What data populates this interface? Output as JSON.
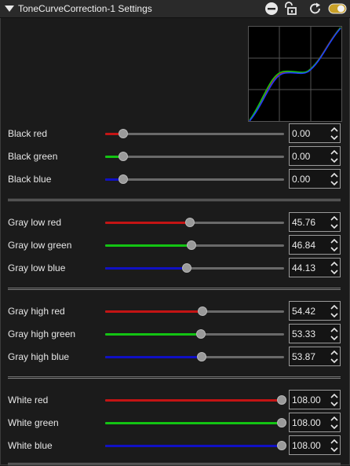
{
  "window": {
    "title": "ToneCurveCorrection-1 Settings"
  },
  "icons": {
    "collapse": "chevron-down-icon",
    "remove": "minus-circle-icon",
    "lock": "unlock-icon",
    "reset": "reset-icon",
    "toggle": "toggle-on-icon"
  },
  "colors": {
    "red": "#c41414",
    "green": "#13c413",
    "blue": "#1010c4",
    "toggle": "#c8a028"
  },
  "groups": [
    {
      "rows": [
        {
          "label": "Black red",
          "value": "0.00",
          "fraction": 0.1,
          "color": "red"
        },
        {
          "label": "Black green",
          "value": "0.00",
          "fraction": 0.1,
          "color": "green"
        },
        {
          "label": "Black blue",
          "value": "0.00",
          "fraction": 0.1,
          "color": "blue"
        }
      ]
    },
    {
      "rows": [
        {
          "label": "Gray low red",
          "value": "45.76",
          "fraction": 0.475,
          "color": "red"
        },
        {
          "label": "Gray low green",
          "value": "46.84",
          "fraction": 0.483,
          "color": "green"
        },
        {
          "label": "Gray low blue",
          "value": "44.13",
          "fraction": 0.458,
          "color": "blue"
        }
      ]
    },
    {
      "rows": [
        {
          "label": "Gray high red",
          "value": "54.42",
          "fraction": 0.545,
          "color": "red"
        },
        {
          "label": "Gray high green",
          "value": "53.33",
          "fraction": 0.535,
          "color": "green"
        },
        {
          "label": "Gray high blue",
          "value": "53.87",
          "fraction": 0.54,
          "color": "blue"
        }
      ]
    },
    {
      "rows": [
        {
          "label": "White red",
          "value": "108.00",
          "fraction": 0.985,
          "color": "red"
        },
        {
          "label": "White green",
          "value": "108.00",
          "fraction": 0.985,
          "color": "green"
        },
        {
          "label": "White blue",
          "value": "108.00",
          "fraction": 0.985,
          "color": "blue"
        }
      ]
    }
  ]
}
